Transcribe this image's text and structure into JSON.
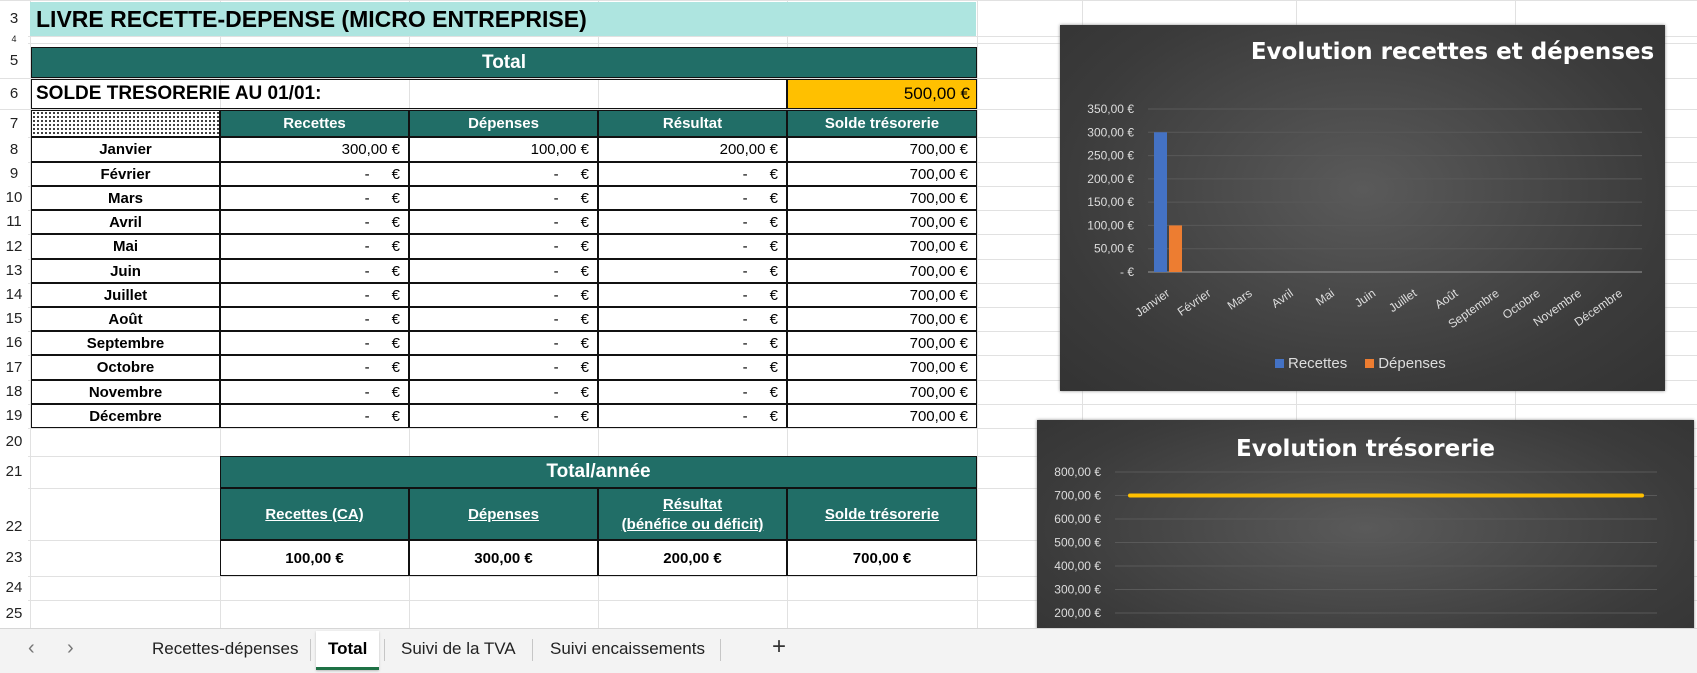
{
  "sheet": {
    "title": "LIVRE RECETTE-DEPENSE (MICRO ENTREPRISE)",
    "total_header": "Total",
    "solde_label": "SOLDE TRESORERIE AU 01/01:",
    "solde_value": "500,00 €",
    "columns": [
      "Recettes",
      "Dépenses",
      "Résultat",
      "Solde trésorerie"
    ],
    "rows": [
      {
        "month": "Janvier",
        "recettes": "300,00 €",
        "depenses": "100,00 €",
        "resultat": "200,00 €",
        "solde": "700,00 €"
      },
      {
        "month": "Février",
        "recettes": "-",
        "depenses": "-",
        "resultat": "-",
        "solde": "700,00 €"
      },
      {
        "month": "Mars",
        "recettes": "-",
        "depenses": "-",
        "resultat": "-",
        "solde": "700,00 €"
      },
      {
        "month": "Avril",
        "recettes": "-",
        "depenses": "-",
        "resultat": "-",
        "solde": "700,00 €"
      },
      {
        "month": "Mai",
        "recettes": "-",
        "depenses": "-",
        "resultat": "-",
        "solde": "700,00 €"
      },
      {
        "month": "Juin",
        "recettes": "-",
        "depenses": "-",
        "resultat": "-",
        "solde": "700,00 €"
      },
      {
        "month": "Juillet",
        "recettes": "-",
        "depenses": "-",
        "resultat": "-",
        "solde": "700,00 €"
      },
      {
        "month": "Août",
        "recettes": "-",
        "depenses": "-",
        "resultat": "-",
        "solde": "700,00 €"
      },
      {
        "month": "Septembre",
        "recettes": "-",
        "depenses": "-",
        "resultat": "-",
        "solde": "700,00 €"
      },
      {
        "month": "Octobre",
        "recettes": "-",
        "depenses": "-",
        "resultat": "-",
        "solde": "700,00 €"
      },
      {
        "month": "Novembre",
        "recettes": "-",
        "depenses": "-",
        "resultat": "-",
        "solde": "700,00 €"
      },
      {
        "month": "Décembre",
        "recettes": "-",
        "depenses": "-",
        "resultat": "-",
        "solde": "700,00 €"
      }
    ],
    "euro_sign": "€",
    "annual": {
      "header": "Total/année",
      "col1": "Recettes (CA)",
      "col2": "Dépenses",
      "col3_line1": "Résultat",
      "col3_line2": "(bénéfice ou déficit)",
      "col4": "Solde trésorerie",
      "v1": "100,00 €",
      "v2": "300,00 €",
      "v3": "200,00 €",
      "v4": "700,00 €"
    },
    "row_numbers": [
      "3",
      "4",
      "5",
      "6",
      "7",
      "8",
      "9",
      "10",
      "11",
      "12",
      "13",
      "14",
      "15",
      "16",
      "17",
      "18",
      "19",
      "20",
      "21",
      "22",
      "23",
      "24",
      "25"
    ]
  },
  "chart_data": [
    {
      "type": "bar",
      "title": "Evolution recettes et dépenses",
      "categories": [
        "Janvier",
        "Février",
        "Mars",
        "Avril",
        "Mai",
        "Juin",
        "Juillet",
        "Août",
        "Septembre",
        "Octobre",
        "Novembre",
        "Décembre"
      ],
      "series": [
        {
          "name": "Recettes",
          "color": "#4472c4",
          "values": [
            300,
            0,
            0,
            0,
            0,
            0,
            0,
            0,
            0,
            0,
            0,
            0
          ]
        },
        {
          "name": "Dépenses",
          "color": "#ed7d31",
          "values": [
            100,
            0,
            0,
            0,
            0,
            0,
            0,
            0,
            0,
            0,
            0,
            0
          ]
        }
      ],
      "ylim": [
        0,
        350
      ],
      "yticks": [
        "350,00 €",
        "300,00 €",
        "250,00 €",
        "200,00 €",
        "150,00 €",
        "100,00 €",
        "50,00 €",
        "-   €"
      ],
      "legend": "bottom",
      "grid": true
    },
    {
      "type": "line",
      "title": "Evolution trésorerie",
      "series": [
        {
          "color": "#ffc000",
          "values": [
            700,
            700,
            700,
            700,
            700,
            700,
            700,
            700,
            700,
            700,
            700,
            700
          ]
        }
      ],
      "yticks": [
        "800,00 €",
        "700,00 €",
        "600,00 €",
        "500,00 €",
        "400,00 €",
        "300,00 €",
        "200,00 €"
      ],
      "ylim": [
        200,
        800
      ],
      "grid": true
    }
  ],
  "tabs": {
    "items": [
      "Recettes-dépenses",
      "Total",
      "Suivi de la TVA",
      "Suivi encaissements"
    ],
    "active": "Total",
    "prev_icon": "‹",
    "next_icon": "›",
    "add_icon": "+"
  }
}
